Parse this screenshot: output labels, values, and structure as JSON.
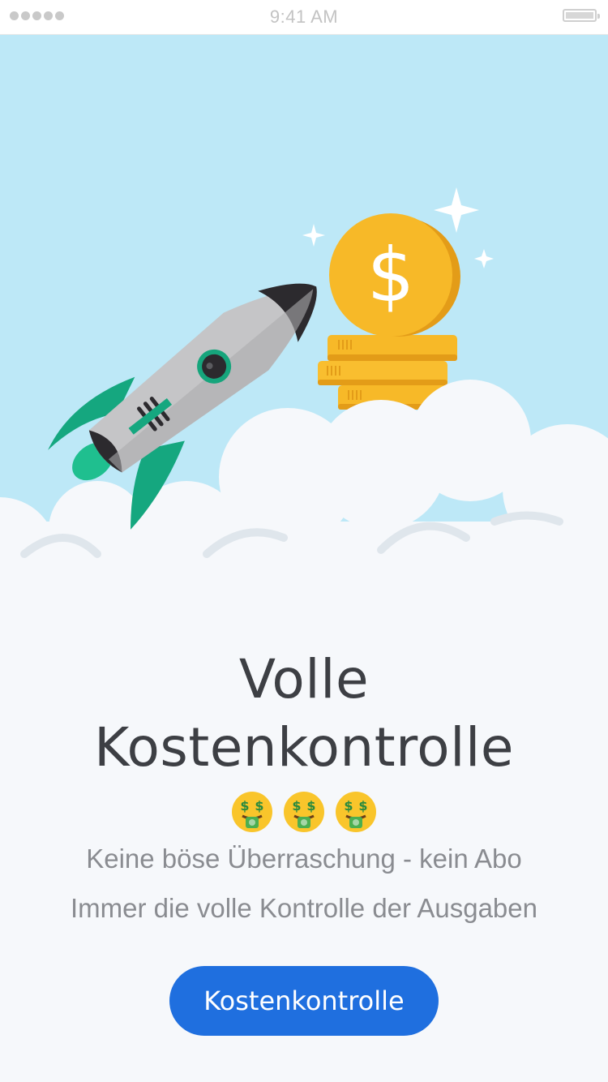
{
  "status_bar": {
    "time": "9:41 AM",
    "signal_dots": 5,
    "battery_level": 1.0
  },
  "hero": {
    "illustration": [
      "rocket-icon",
      "dollar-coin-icon",
      "coin-stack-icon",
      "sparkle-icon",
      "cloud-icon"
    ],
    "colors": {
      "sky": "#bde8f7",
      "cloud": "#f6f8fb",
      "rocket_body": "#c5c5c7",
      "rocket_nose": "#2c2a2e",
      "rocket_fins": "#15a77f",
      "coin": "#f7b928"
    }
  },
  "content": {
    "title_line1": "Volle",
    "title_line2": "Kostenkontrolle",
    "emoji": "🤑 🤑 🤑",
    "subtitle1": "Keine böse Überraschung - kein Abo",
    "subtitle2": "Immer die volle Kontrolle der Ausgaben"
  },
  "cta": {
    "label": "Kostenkontrolle",
    "color": "#1f6fdf"
  }
}
